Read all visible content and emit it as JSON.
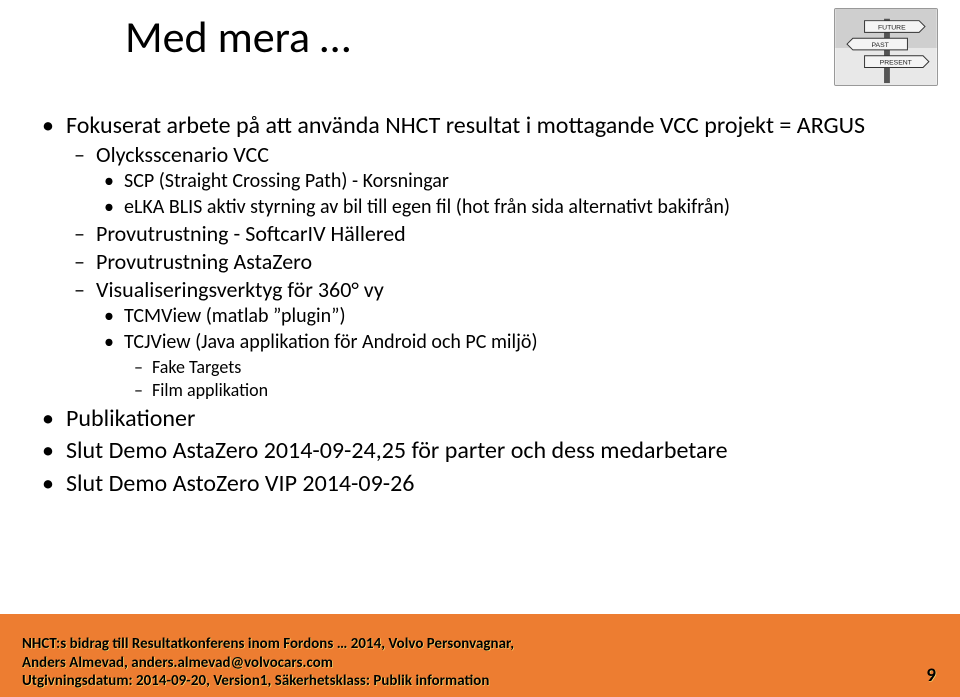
{
  "title": "Med mera …",
  "signpost": {
    "labels": [
      "FUTURE",
      "PAST",
      "PRESENT"
    ]
  },
  "bullets": {
    "l1_0": "Fokuserat arbete på att använda NHCT resultat i mottagande  VCC projekt = ARGUS",
    "l1_0_l2_0": "Olycksscenario VCC",
    "l1_0_l2_0_l3_0": "SCP (Straight Crossing Path) - Korsningar",
    "l1_0_l2_0_l3_1": "eLKA BLIS aktiv styrning av bil till egen fil (hot från sida alternativt bakifrån)",
    "l1_0_l2_1": "Provutrustning - SoftcarIV Hällered",
    "l1_0_l2_2": "Provutrustning AstaZero",
    "l1_0_l2_3": "Visualiseringsverktyg för 360° vy",
    "l1_0_l2_3_l3_0": "TCMView (matlab ”plugin”)",
    "l1_0_l2_3_l3_1": "TCJView (Java applikation för Android och PC miljö)",
    "l1_0_l2_3_l3_1_l4_0": "Fake Targets",
    "l1_0_l2_3_l3_1_l4_1": "Film applikation",
    "l1_1": "Publikationer",
    "l1_2": "Slut Demo AstaZero 2014-09-24,25 för parter och dess medarbetare",
    "l1_3": "Slut Demo AstoZero VIP 2014-09-26"
  },
  "footer": {
    "line1": "NHCT:s bidrag till Resultatkonferens inom Fordons … 2014, Volvo Personvagnar,",
    "line2": "Anders Almevad, anders.almevad@volvocars.com",
    "line3": "Utgivningsdatum: 2014-09-20, Version1, Säkerhetsklass: Publik information"
  },
  "page_number": "9"
}
